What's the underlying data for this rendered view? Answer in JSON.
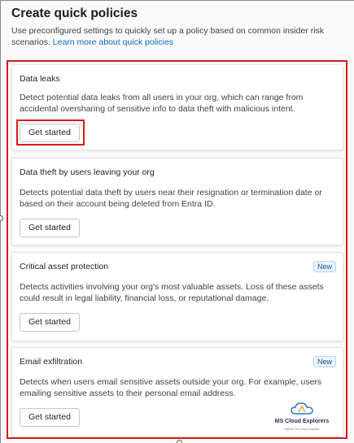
{
  "header": {
    "title": "Create quick policies",
    "description": "Use preconfigured settings to quickly set up a policy based on common insider risk scenarios.",
    "learn_more_link": "Learn more about quick policies"
  },
  "cards": [
    {
      "title": "Data leaks",
      "description": "Detect potential data leaks from all users in your org, which can range from accidental oversharing of sensitive info to data theft with malicious intent.",
      "button_label": "Get started",
      "badge": ""
    },
    {
      "title": "Data theft by users leaving your org",
      "description": "Detects potential data theft by users near their resignation or termination date or based on their account being deleted from Entra ID.",
      "button_label": "Get started",
      "badge": ""
    },
    {
      "title": "Critical asset protection",
      "description": "Detects activities involving your org's most valuable assets. Loss of these assets could result in legal liability, financial loss, or reputational damage.",
      "button_label": "Get started",
      "badge": "New"
    },
    {
      "title": "Email exfiltration",
      "description": "Detects when users email sensitive assets outside your org. For example, users emailing sensitive assets to their personal email address.",
      "button_label": "Get started",
      "badge": "New"
    }
  ],
  "watermark": {
    "name": "MS Cloud Explorers",
    "tagline": "Explore The Cloud Together"
  },
  "colors": {
    "accent": "#0f6cbd",
    "highlight": "#d01c1c",
    "badge_bg": "#ebf3fc",
    "badge_text": "#0f548c"
  }
}
